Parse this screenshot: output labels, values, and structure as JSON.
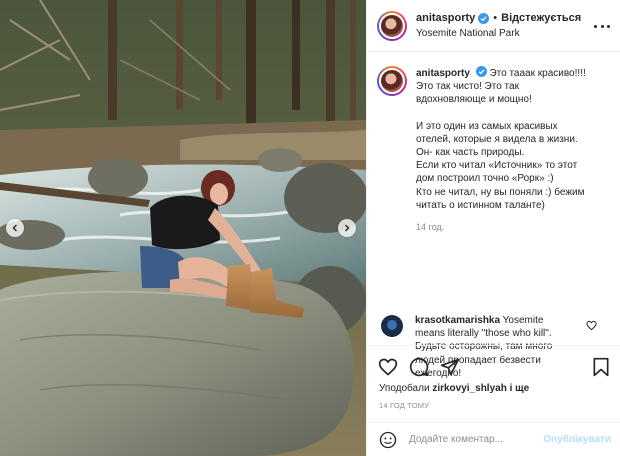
{
  "post": {
    "author": {
      "username": "anitasporty",
      "verified": true,
      "follow_status": "Відстежується",
      "location": "Yosemite National Park"
    },
    "caption": {
      "username": "anitasporty",
      "lines_first": [
        "Это тааак красиво!!!!",
        "Это так чисто! Это так",
        "вдохновляюще и мощно!"
      ],
      "lines_second": [
        "И это один из самых красивых",
        "отелей, которые я видела в жизни.",
        "Он- как часть природы.",
        "Если кто читал «Источник» то этот",
        "дом построил точно «Рорк» :)",
        "Кто не читал, ну вы поняли :) бежим",
        "читать о истинном таланте)"
      ],
      "time": "14 год."
    },
    "reply": {
      "username": "krasotkamarishka",
      "lines": [
        "Yosemite",
        "means literally \"those who kill\".",
        "Будьте осторожны, там много",
        "людей пропадает безвести",
        "ежегодно!"
      ]
    },
    "likes": {
      "prefix": "Уподобали",
      "user": "zirkovyi_shlyah",
      "suffix": "і ще"
    },
    "timestamp": "14 ГОД ТОМУ",
    "comment_input": {
      "placeholder": "Додайте коментар...",
      "value": ""
    },
    "publish_label": "Опублікувати"
  },
  "icons": {
    "more": "more-horizontal-icon",
    "verified": "verified-badge-icon",
    "like": "heart-icon",
    "comment": "comment-bubble-icon",
    "share": "paper-plane-icon",
    "save": "bookmark-icon",
    "emoji": "emoji-smile-icon",
    "carousel_prev": "chevron-left-icon",
    "carousel_next": "chevron-right-icon"
  },
  "colors": {
    "verified": "#3897f0",
    "publish_disabled": "#b2dffc",
    "secondary_text": "#8e8e8e",
    "primary_text": "#262626",
    "border": "#efefef"
  }
}
